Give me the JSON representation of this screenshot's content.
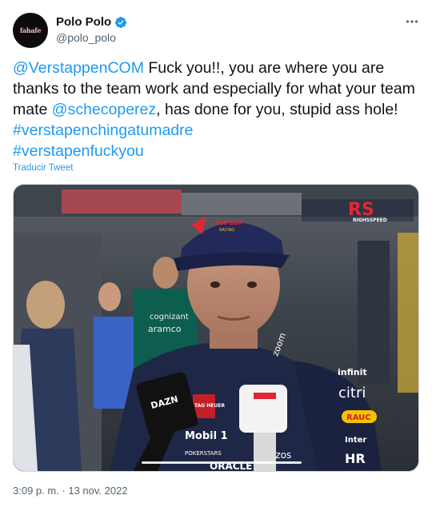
{
  "author": {
    "display_name": "Polo Polo",
    "handle": "@polo_polo",
    "avatar_text": "fahafe"
  },
  "tweet": {
    "mention_1": "@VerstappenCOM",
    "text_1": " Fuck you!!, you are where you are thanks to the team work and especially for what your team mate ",
    "mention_2": "@schecoperez",
    "text_2": ", has done for you, stupid ass hole! ",
    "hashtag_1": "#verstapenchingatumadre",
    "hashtag_2": "#verstapenfuckyou",
    "translate_label": "Traducir Tweet",
    "timestamp": "3:09 p. m. · 13 nov. 2022"
  },
  "media": {
    "watermark_top": "RS",
    "watermark_sub": "RIGHSSPEED",
    "cap_brand": "Red Bull",
    "cap_brand_sub": "RACING",
    "mic_label": "DAZN",
    "tag_label": "TAG HEUER",
    "mobil_label": "Mobil 1",
    "pokerstars_label": "POKERSTARS",
    "zoom_label": "zoom",
    "oracle_label": "ORACLE",
    "citrix_label": "citri",
    "infiniti_label": "infinit",
    "bybit_label": "ezos",
    "rauch_label": "RAUC",
    "intel_label": "Inter",
    "honda_label": "HR",
    "cognizant_label": "cognizant",
    "aramco_label": "aramco"
  },
  "icons": {
    "verified": "verified-badge-icon",
    "more": "more-options-icon"
  },
  "colors": {
    "link": "#1d9bf0",
    "secondary_text": "#536471",
    "verified_blue": "#1d9bf0"
  }
}
